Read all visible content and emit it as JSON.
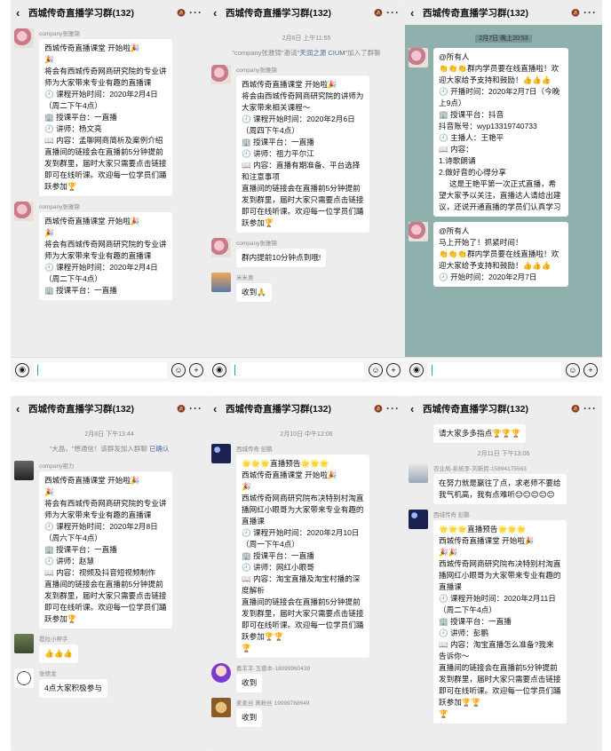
{
  "title": "西城传奇直播学习群(132)",
  "input_bar": {
    "voice_glyph": "◉",
    "emoji_glyph": "☺",
    "plus_glyph": "+"
  },
  "panels": [
    {
      "messages": [
        {
          "nick": "company张雅锦",
          "text": "西城传奇直播课堂 开始啦🎉\n🎉\n将会有西城传奇网商研究院的专业讲师为大家带来专业有趣的直播课\n🕘 课程开始时间：2020年2月4日（周二下午4点）\n🏢 授课平台：一直播\n🕘 讲师：杨文亮\n📖 内容：孟聊网商简析及案例介绍\n直播间的链接会在直播前5分钟提前发到群里，届时大家只需要点击链接即可在线听课。欢迎每一位学员们踊跃参加🏆"
        },
        {
          "nick": "company张雅锦",
          "text": "西城传奇直播课堂 开始啦🎉\n🎉\n将会有西城传奇网商研究院的专业讲师为大家带来专业有趣的直播课\n🕘 课程开始时间：2020年2月4日（周二下午4点）\n🏢 授课平台：一直播"
        }
      ]
    },
    {
      "timestamp": "2月6日 上午11:55",
      "system": {
        "pre": "\"company张雅锦\"邀请\"",
        "link": "天润之源 CIUM",
        "post": "\"加入了群聊"
      },
      "messages": [
        {
          "nick": "company张雅锦",
          "text": "西城传奇直播课堂 开始啦🎉\n将会由西城传奇网商研究院的讲师为大家带来相关课程～\n🕘 课程开始时间：2020年2月6日（周四下午4点）\n🏢 授课平台：一直播\n🕘 讲师：祖力平尔江\n📖 内容：直播有期准备、平台选择和注意事项\n直播间的链接会在直播前5分钟提前发到群里，届时大家只需要点击链接即可在线听课。欢迎每一位学员们踊跃参加🏆"
        },
        {
          "nick": "company张雅锦",
          "text": "群内提前10分钟点到哦!"
        },
        {
          "nick": "米米奥",
          "text": "收到🙏"
        }
      ]
    },
    {
      "timestamp": "2月7日 晚上20:53",
      "messages": [
        {
          "nick": "",
          "text": "@所有人\n👏👏👏群内学员要在线直播啦！欢迎大家给予支持和鼓励！👍👍👍\n🕘 开播时间：2020年2月7日（今晚上9点）\n🏢 授课平台：抖音\n抖音账号：wyp13319740733\n🕘 主播人：王艳平\n📖 内容：\n1.诗歌朗诵\n2.做好音的心得分享\n     这是王艳平第一次正式直播，希望大家予以关注，直播达人请给出建议，还说开通直播的学员们认真学习"
        },
        {
          "nick": "",
          "text": "@所有人\n马上开始了！抓紧时间！\n👏👏👏群内学员要在线直播啦！欢迎大家给予支持和鼓励！👍👍👍\n🕘 开始时间：2020年2月7日"
        }
      ]
    },
    {
      "timestamp": "2月8日 下午13:44",
      "system": {
        "pre": "\"大晶，\"想通信！该群发加入群聊 ",
        "link": "已确认",
        "post": ""
      },
      "messages": [
        {
          "nick": "company祖力",
          "text": "西城传奇直播课堂 开始啦🎉\n🎉\n将会有西城传奇网商研究院的专业讲师为大家带来专业有趣的直播课\n🕘 课程开始时间：2020年2月8日（周六下午4点）\n🏢 授课平台：一直播\n🕘 讲师：赵慧\n📖 内容：视频及抖音短视频制作\n直播间的链接会在直播前5分钟提前发到群里，届时大家只需要点击链接即可在线听课。欢迎每一位学员们踊跃参加🏆"
        },
        {
          "nick": "提拉小帮手",
          "text": "👍👍👍"
        },
        {
          "nick": "张德龙",
          "text": "4点大家积极参与"
        }
      ]
    },
    {
      "timestamp": "2月10日 中午12:06",
      "messages": [
        {
          "nick": "西城传奇 彭鹏",
          "text": "🌟🌟🌟直播预告🌟🌟🌟\n西城传奇直播课堂 开始啦🎉\n🎉\n西城传奇网商研究院布决特别村淘直播网红小眼哥为大家带来专业有趣的直播课\n🕘 课程开始时间：2020年2月10日（周一下午4点）\n🏢 授课平台：一直播\n🕘 讲师：网红小眼哥\n📖 内容：淘宝直播及淘宝村播的深度解析\n直播间的链接会在直播前5分钟提前发到群里，届时大家只需要点击链接即可在线听课。欢迎每一位学员们踊跃参加🏆🏆\n🏆"
        },
        {
          "nick": "喜羊羊·玉蓉本-18099960439",
          "text": "收到"
        },
        {
          "nick": "麦麦丝 真粉丝 19999788649",
          "text": "收到"
        }
      ]
    },
    {
      "messages_top": [
        {
          "nick": "",
          "text": "请大家多多指点🏆🏆🏆"
        }
      ],
      "timestamp": "2月11日 下午13:06",
      "messages": [
        {
          "nick": "农业局-系统李-刘新民-15894175563",
          "text": "在努力就是赢往了点，求老师不要给我气机高，我有点难听😊😊😊😊😊"
        },
        {
          "nick": "西城传奇 彭鹏",
          "text": "🌟🌟🌟直播预告🌟🌟🌟\n西城传奇直播课堂 开始啦🎉\n🎉🎉\n西城传奇网商研究院布决特别村淘直播网红小眼哥为大家带来专业有趣的直播课\n🕘 课程开始时间：2020年2月11日（周二下午4点）\n🏢 授课平台：一直播\n🕘 讲师：彭鹏\n📖 内容：淘宝直播怎么准备?我来告诉你～\n直播间的链接会在直播前5分钟提前发到群里，届时大家只需要点击链接即可在线听课。欢迎每一位学员们踊跃参加🏆🏆\n🏆"
        }
      ]
    }
  ]
}
